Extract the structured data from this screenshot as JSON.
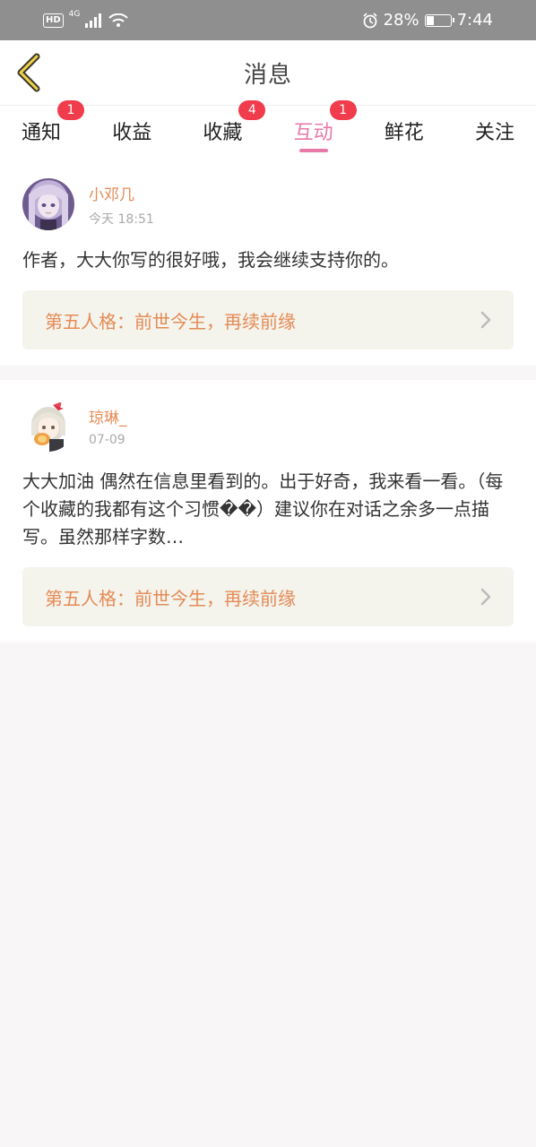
{
  "status_bar": {
    "hd": "HD",
    "network": "4G",
    "battery_percent": "28%",
    "time": "7:44"
  },
  "header": {
    "title": "消息"
  },
  "tabs": [
    {
      "label": "通知",
      "badge": "1"
    },
    {
      "label": "收益",
      "badge": ""
    },
    {
      "label": "收藏",
      "badge": "4"
    },
    {
      "label": "互动",
      "badge": "1",
      "active": true
    },
    {
      "label": "鲜花",
      "badge": ""
    },
    {
      "label": "关注",
      "badge": ""
    }
  ],
  "messages": [
    {
      "username": "小邓几",
      "time": "今天 18:51",
      "comment": "作者，大大你写的很好哦，我会继续支持你的。",
      "work_title": "第五人格：前世今生，再续前缘"
    },
    {
      "username": "琼琳_",
      "time": "07-09",
      "comment": "大大加油 偶然在信息里看到的。出于好奇，我来看一看。（每个收藏的我都有这个习惯��）建议你在对话之余多一点描写。虽然那样字数…",
      "work_title": "第五人格：前世今生，再续前缘"
    }
  ],
  "colors": {
    "accent_pink": "#e87aa8",
    "username_orange": "#e48b56",
    "badge_red": "#f03c4c",
    "link_bg": "#f4f3ec"
  }
}
